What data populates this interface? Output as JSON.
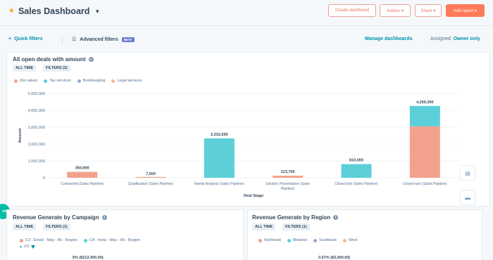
{
  "header": {
    "title": "Sales Dashboard",
    "buttons": {
      "create_dashboard": "Create dashboard",
      "actions": "Actions ▾",
      "share": "Share ▾",
      "add_report": "Add report ▾"
    }
  },
  "filterbar": {
    "quick_filters": "Quick filters",
    "advanced_filters": "Advanced filters",
    "beta": "BETA",
    "manage": "Manage dashboards",
    "assigned_label": "Assigned:",
    "assigned_value": "Owner only"
  },
  "main_report": {
    "title": "All open deals with amount",
    "chip_time": "ALL TIME",
    "chip_filters": "FILTERS (2)",
    "legend": [
      {
        "label": "(No value)",
        "color": "#f2a28c"
      },
      {
        "label": "Tax services",
        "color": "#5ccfd9"
      },
      {
        "label": "Bookkeeping",
        "color": "#9aa7d6"
      },
      {
        "label": "Legal services",
        "color": "#f5b98f"
      }
    ]
  },
  "chart_data": {
    "type": "bar",
    "ylabel": "Amount",
    "xlabel": "Deal Stage",
    "ylim": [
      0,
      5000000
    ],
    "yticks": [
      "0",
      "1,000,000",
      "2,000,000",
      "3,000,000",
      "4,000,000",
      "5,000,000"
    ],
    "categories": [
      [
        "Contracted (Sales Pipeline)"
      ],
      [
        "Qualification (Sales Pipeline)"
      ],
      [
        "Needs Analysis (Sales Pipeline)"
      ],
      [
        "Solution Presentation (Sales",
        "Pipeline)"
      ],
      [
        "Closed lost (Sales Pipeline)"
      ],
      [
        "Closed won (Sales Pipeline)"
      ]
    ],
    "totals": [
      "350,900",
      "7,500",
      "2,332,650",
      "123,700",
      "810,000",
      "4,259,300"
    ],
    "series": [
      {
        "name": "(No value)",
        "color": "#f2a28c",
        "values": [
          350900,
          7500,
          0,
          123700,
          0,
          3050000
        ]
      },
      {
        "name": "Tax services",
        "color": "#5ccfd9",
        "values": [
          0,
          0,
          2332650,
          0,
          810000,
          1209300
        ]
      }
    ],
    "grid": true,
    "legend_position": "top-left"
  },
  "campaign_report": {
    "title": "Revenue Generate by Campaign",
    "chip_time": "ALL TIME",
    "chip_filters": "FILTERS (1)",
    "legend": [
      {
        "label": "C3 - Email - May - All - Region",
        "color": "#f2a28c"
      },
      {
        "label": "C4 - Insta - May - All - Region",
        "color": "#5ccfd9"
      }
    ],
    "page": "1/2",
    "value": "5% ($212,000.00)"
  },
  "region_report": {
    "title": "Revenue Generate by Region",
    "chip_time": "ALL TIME",
    "chip_filters": "FILTERS (1)",
    "legend": [
      {
        "label": "Northeast",
        "color": "#f2a28c"
      },
      {
        "label": "Midwest",
        "color": "#5ccfd9"
      },
      {
        "label": "Southeast",
        "color": "#9aa7d6"
      },
      {
        "label": "West",
        "color": "#f5b98f"
      }
    ],
    "value": "0.07% ($3,000.00)"
  },
  "side_tab": "nto",
  "icons": [
    "star-icon",
    "chevron-down-icon",
    "plus-icon",
    "sliders-icon",
    "info-icon",
    "table-icon",
    "comment-icon"
  ]
}
